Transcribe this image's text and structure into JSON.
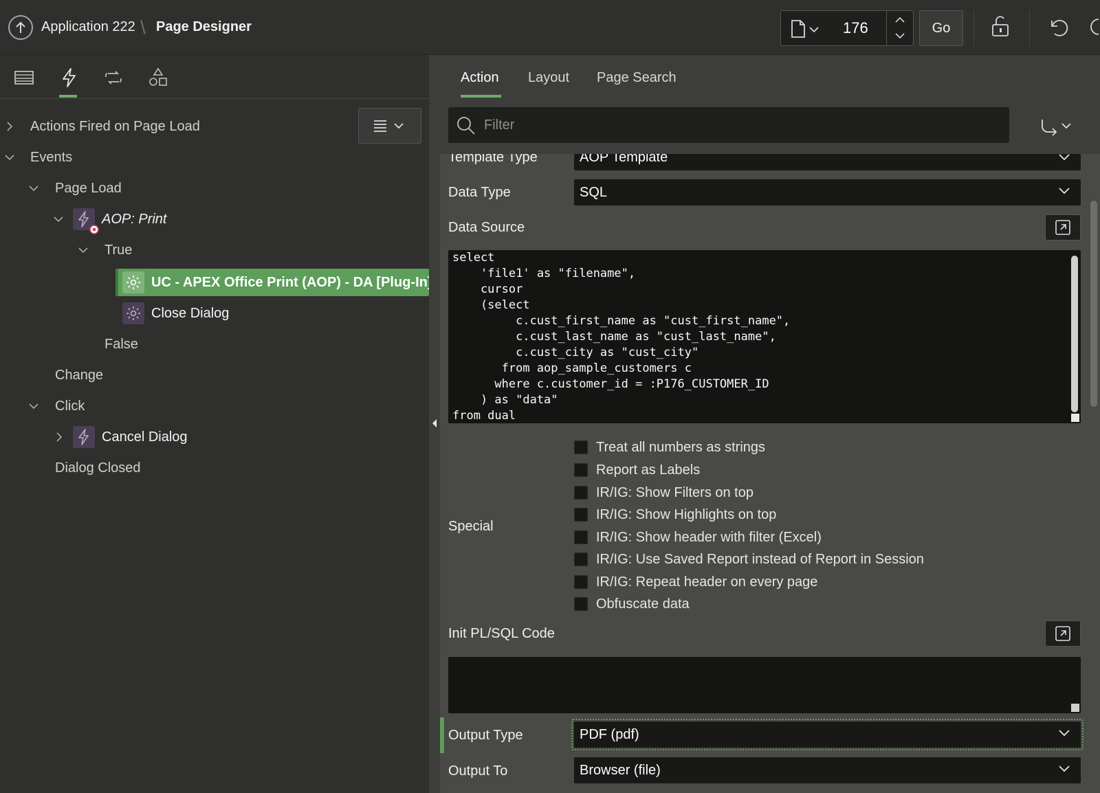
{
  "header": {
    "app_title": "Application 222",
    "separator": "\\",
    "page_designer": "Page Designer",
    "page_number": "176",
    "go_label": "Go"
  },
  "left": {
    "tabs": [
      "rendering-icon",
      "dynamic-actions-icon",
      "processing-icon",
      "shared-components-icon"
    ],
    "tree": {
      "actions_fired": "Actions Fired on Page Load",
      "events": "Events",
      "page_load": "Page Load",
      "aop_print": "AOP: Print",
      "true_label": "True",
      "selected_action": "UC - APEX Office Print (AOP) - DA [Plug-In]",
      "close_dialog": "Close Dialog",
      "false_label": "False",
      "change": "Change",
      "click": "Click",
      "cancel_dialog": "Cancel Dialog",
      "dialog_closed": "Dialog Closed"
    }
  },
  "right": {
    "tabs": {
      "action": "Action",
      "layout": "Layout",
      "page_search": "Page Search"
    },
    "filter_placeholder": "Filter",
    "template_type_label": "Template Type",
    "template_type_value": "AOP Template",
    "data_type_label": "Data Type",
    "data_type_value": "SQL",
    "data_source_label": "Data Source",
    "code": [
      "select",
      "    'file1' as \"filename\",",
      "    cursor",
      "    (select",
      "         c.cust_first_name as \"cust_first_name\",",
      "         c.cust_last_name as \"cust_last_name\",",
      "         c.cust_city as \"cust_city\"",
      "       from aop_sample_customers c",
      "      where c.customer_id = :P176_CUSTOMER_ID",
      "    ) as \"data\"",
      "from dual"
    ],
    "special_label": "Special",
    "special_options": [
      "Treat all numbers as strings",
      "Report as Labels",
      "IR/IG: Show Filters on top",
      "IR/IG: Show Highlights on top",
      "IR/IG: Show header with filter (Excel)",
      "IR/IG: Use Saved Report instead of Report in Session",
      "IR/IG: Repeat header on every page",
      "Obfuscate data"
    ],
    "init_label": "Init PL/SQL Code",
    "output_type_label": "Output Type",
    "output_type_value": "PDF (pdf)",
    "output_to_label": "Output To",
    "output_to_value": "Browser (file)"
  },
  "colors": {
    "accent_green": "#5c9e5a",
    "da_purple": "#4b3f55"
  }
}
